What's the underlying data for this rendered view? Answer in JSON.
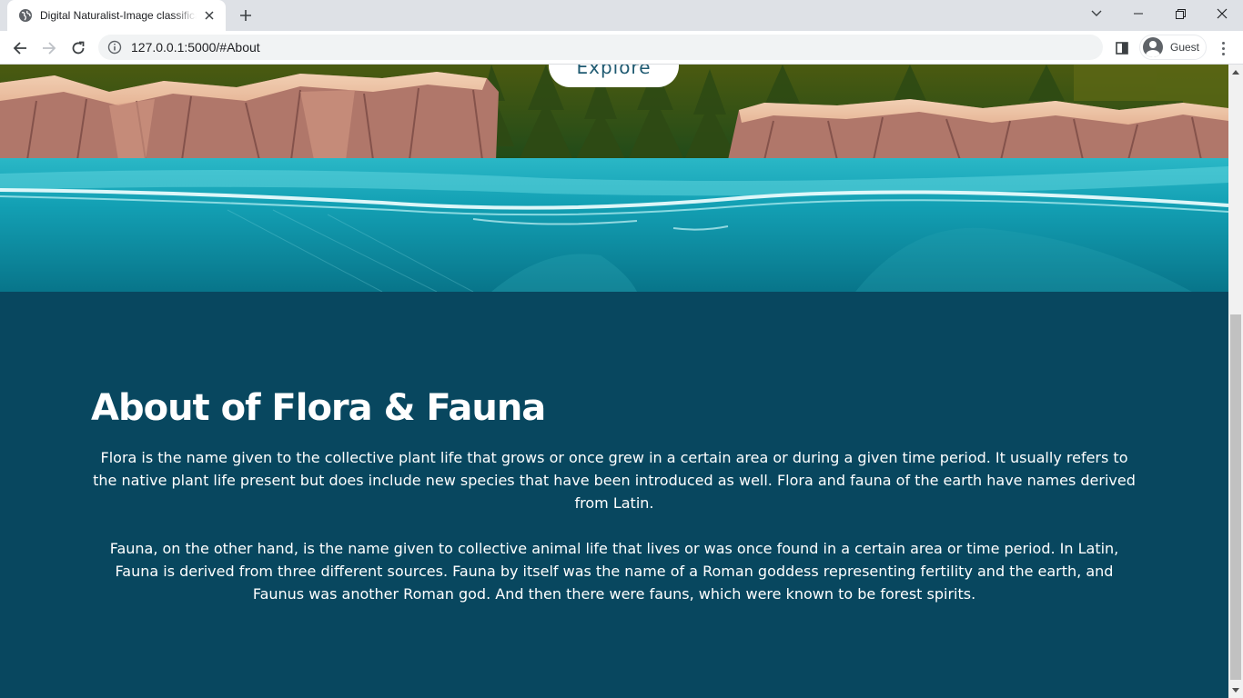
{
  "browser": {
    "tab_title": "Digital Naturalist-Image classification",
    "url": "127.0.0.1:5000/#About",
    "profile_name": "Guest"
  },
  "hero": {
    "explore_label": "Explore"
  },
  "about": {
    "title": "About of Flora & Fauna",
    "paragraph1": "Flora is the name given to the collective plant life that grows or once grew in a certain area or during a given time period. It usually refers to the native plant life present but does include new species that have been introduced as well. Flora and fauna of the earth have names derived from Latin.",
    "paragraph2": "Fauna, on the other hand, is the name given to collective animal life that lives or was once found in a certain area or time period. In Latin, Fauna is derived from three different sources. Fauna by itself was the name of a Roman goddess representing fertility and the earth, and Faunus was another Roman god. And then there were fauns, which were known to be forest spirits."
  },
  "colors": {
    "section_bg": "#08475f",
    "water": "#0e8fa3",
    "cliff": "#c8907a"
  }
}
